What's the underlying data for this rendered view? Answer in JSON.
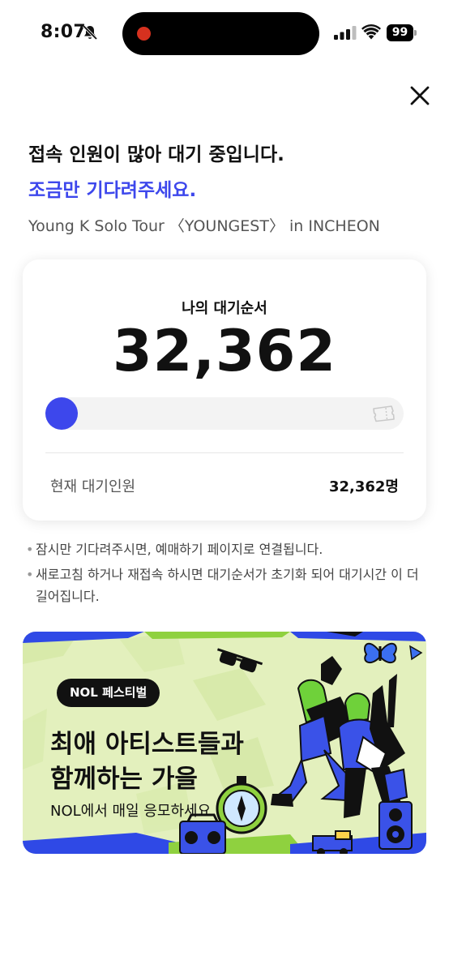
{
  "status_bar": {
    "time": "8:07",
    "battery": "99"
  },
  "queue": {
    "heading": "접속 인원이 많아 대기 중입니다.",
    "subheading": "조금만 기다려주세요.",
    "event_title": "Young K Solo Tour 〈YOUNGEST〉 in INCHEON",
    "my_position_label": "나의 대기순서",
    "my_position": "32,362",
    "progress_fraction": 0.0,
    "current_waiting_label": "현재 대기인원",
    "current_waiting_value": "32,362명"
  },
  "notes": [
    "잠시만 기다려주시면, 예매하기 페이지로 연결됩니다.",
    "새로고침 하거나 재접속 하시면 대기순서가 초기화 되어 대기시간 이 더 길어집니다."
  ],
  "banner": {
    "chip": "NOL 페스티벌",
    "title_line1": "최애 아티스트들과",
    "title_line2": "함께하는 가을",
    "subtitle": "NOL에서 매일 응모하세요"
  },
  "colors": {
    "accent": "#3d47ec",
    "banner_bg": "#e3f0bd",
    "banner_green": "#8fd13f"
  }
}
